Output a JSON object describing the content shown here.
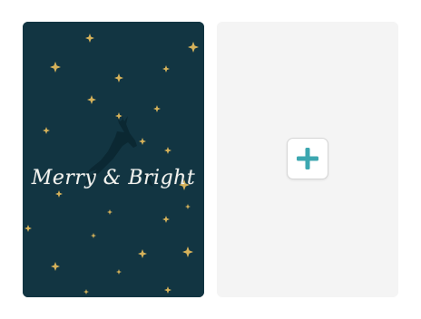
{
  "card": {
    "title": "Merry & Bright",
    "background_color": "#123542",
    "star_color": "#d6b25a"
  },
  "add_panel": {
    "background_color": "#f4f4f4",
    "plus_color": "#3ca7b0",
    "icon": "plus-icon"
  }
}
